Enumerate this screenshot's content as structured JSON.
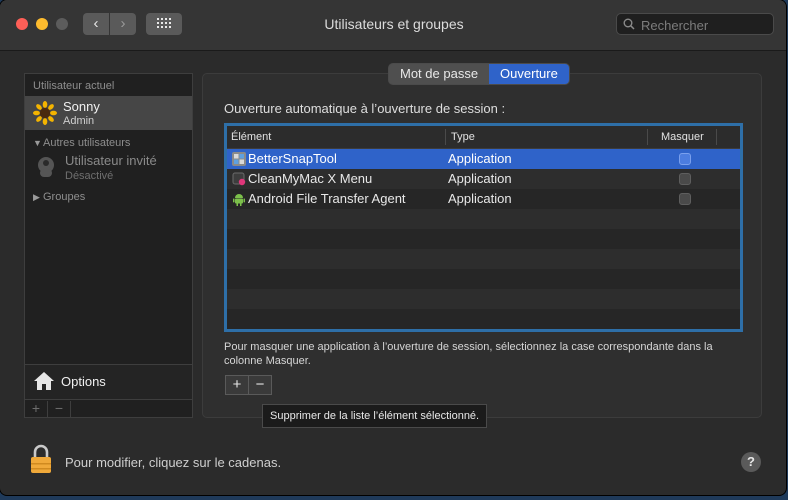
{
  "window": {
    "title": "Utilisateurs et groupes"
  },
  "search": {
    "placeholder": "Rechercher"
  },
  "sidebar": {
    "current_user_section": "Utilisateur actuel",
    "current_user": {
      "name": "Sonny",
      "role": "Admin"
    },
    "other_users_section": "Autres utilisateurs",
    "guest_user": {
      "name": "Utilisateur invité",
      "status": "Désactivé"
    },
    "groups_section": "Groupes",
    "options_label": "Options",
    "add_label": "+",
    "remove_label": "−"
  },
  "tabs": [
    {
      "label": "Mot de passe",
      "active": false
    },
    {
      "label": "Ouverture",
      "active": true
    }
  ],
  "login_items": {
    "heading": "Ouverture automatique à l’ouverture de session :",
    "columns": [
      "Élément",
      "Type",
      "Masquer"
    ],
    "rows": [
      {
        "name": "BetterSnapTool",
        "type": "Application",
        "hide": false,
        "selected": true,
        "icon": "bettersnaptool-icon"
      },
      {
        "name": "CleanMyMac X Menu",
        "type": "Application",
        "hide": false,
        "selected": false,
        "icon": "cleanmymac-icon"
      },
      {
        "name": "Android File Transfer Agent",
        "type": "Application",
        "hide": false,
        "selected": false,
        "icon": "android-icon"
      }
    ],
    "hint": "Pour masquer une application à l’ouverture de session, sélectionnez la case correspondante dans la colonne Masquer.",
    "add_label": "+",
    "remove_label": "−",
    "tooltip": "Supprimer de la liste l’élément sélectionné."
  },
  "footer": {
    "lock_text": "Pour modifier, cliquez sur le cadenas.",
    "help_label": "?"
  },
  "colors": {
    "accent": "#2f63c9",
    "focus_ring": "#2e6fa8",
    "window_bg": "#2b2b2b"
  }
}
